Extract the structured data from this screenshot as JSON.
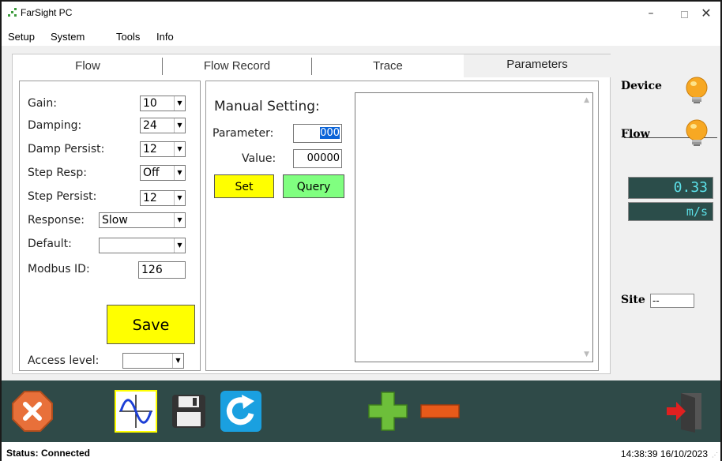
{
  "window": {
    "title": "FarSight PC",
    "minimize": "–",
    "close": "✕"
  },
  "menu": [
    "Setup",
    "System",
    "Tools",
    "Info"
  ],
  "tabs": [
    "Flow",
    "Flow Record",
    "Trace",
    "Parameters"
  ],
  "active_tab": "Parameters",
  "settings": {
    "gain": {
      "label": "Gain:",
      "value": "10"
    },
    "damping": {
      "label": "Damping:",
      "value": "24"
    },
    "damp_persist": {
      "label": "Damp Persist:",
      "value": "12"
    },
    "step_resp": {
      "label": "Step Resp:",
      "value": "Off"
    },
    "step_persist": {
      "label": "Step Persist:",
      "value": "12"
    },
    "response": {
      "label": "Response:",
      "value": "Slow"
    },
    "default": {
      "label": "Default:",
      "value": ""
    },
    "modbus_id": {
      "label": "Modbus ID:",
      "value": "126"
    },
    "save_label": "Save",
    "access_level": {
      "label": "Access level:",
      "value": ""
    }
  },
  "manual": {
    "title": "Manual Setting:",
    "parameter_label": "Parameter:",
    "parameter_value": "000",
    "value_label": "Value:",
    "value_value": "00000",
    "set_label": "Set",
    "query_label": "Query"
  },
  "right": {
    "device_label": "Device",
    "flow_label": "Flow",
    "flow_value": "0.33",
    "flow_unit": "m/s",
    "site_label": "Site",
    "site_value": "--"
  },
  "toolbar_icons": [
    "stop-icon",
    "waveform-icon",
    "save-disk-icon",
    "refresh-icon",
    "plus-icon",
    "minus-icon",
    "exit-door-icon"
  ],
  "status": {
    "text": "Status: Connected",
    "datetime": "14:38:39 16/10/2023"
  },
  "colors": {
    "toolbar_bg": "#2f4a48",
    "save_yellow": "#ffff00",
    "query_green": "#80ff80",
    "lcd_bg": "#2b4d4a",
    "lcd_text": "#5ce0e8",
    "bulb": "#f7a823"
  }
}
